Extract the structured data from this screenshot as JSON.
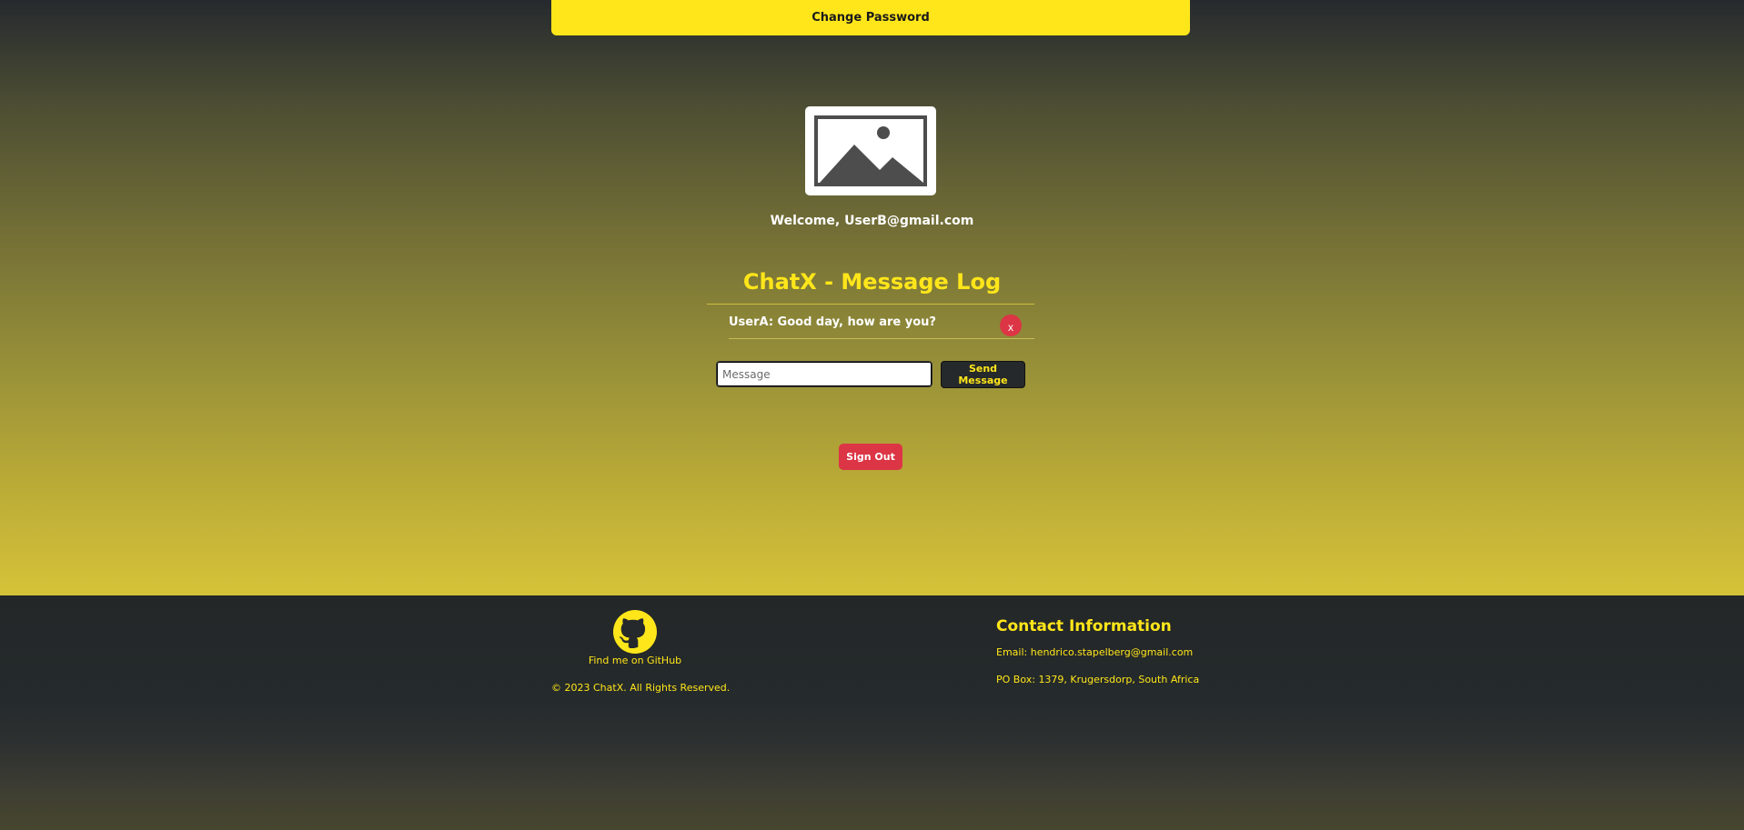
{
  "header": {
    "change_password_label": "Change Password"
  },
  "profile": {
    "avatar_icon": "image-placeholder-icon",
    "welcome_text": "Welcome, UserB@gmail.com"
  },
  "chat": {
    "title": "ChatX - Message Log",
    "messages": [
      {
        "text": "UserA: Good day, how are you?",
        "delete_label": "x"
      }
    ],
    "input_placeholder": "Message",
    "input_value": "",
    "send_label": "Send Message"
  },
  "sign_out_label": "Sign Out",
  "footer": {
    "github_icon": "github-icon",
    "github_link": "Find me on GitHub",
    "copyright": "© 2023 ChatX. All Rights Reserved.",
    "contact_title": "Contact Information",
    "email": "Email: hendrico.stapelberg@gmail.com",
    "po_box": "PO Box: 1379, Krugersdorp, South Africa"
  },
  "colors": {
    "accent_yellow": "#ffe61a",
    "danger_red": "#dc3545",
    "dark": "#25292b"
  }
}
